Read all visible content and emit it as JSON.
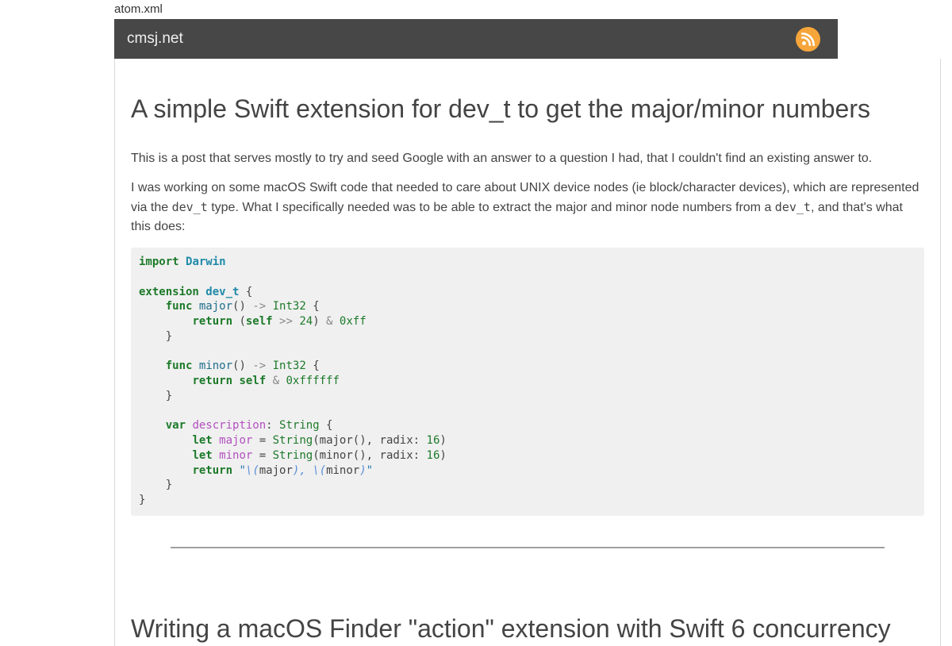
{
  "top_link": {
    "label": "atom.xml"
  },
  "header": {
    "site_title": "cmsj.net",
    "feed_icon": "rss-icon",
    "colors": {
      "bar": "#474747",
      "feed": "#f5a53a"
    }
  },
  "post": {
    "title": "A simple Swift extension for dev_t to get the major/minor numbers",
    "paragraph1": "This is a post that serves mostly to try and seed Google with an answer to a question I had, that I couldn't find an existing answer to.",
    "paragraph2": {
      "text_a": "I was working on some macOS Swift code that needed to care about UNIX device nodes (ie block/character devices), which are represented via the ",
      "code_a": "dev_t",
      "text_b": " type. What I specifically needed was to be able to extract the major and minor node numbers from a ",
      "code_b": "dev_t",
      "text_c": ", and that's what this does:"
    },
    "code": {
      "import_kw": "import",
      "import_mod": "Darwin",
      "extension_kw": "extension",
      "extension_type": "dev_t",
      "func_kw": "func",
      "major_name": "major",
      "minor_name": "minor",
      "arrow": "->",
      "int32": "Int32",
      "return_kw": "return",
      "self_kw": "self",
      "shift_op": ">>",
      "and_op": "&",
      "num_24": "24",
      "mask_ff": "0xff",
      "mask_ffffff": "0xffffff",
      "var_kw": "var",
      "description_name": "description",
      "string_type": "String",
      "let_kw": "let",
      "radix_label": "radix",
      "num_16": "16",
      "interp_open": "\\(",
      "interp_close": ")",
      "interp_sep": ", "
    },
    "colors": {
      "code_bg": "#f0f0f0",
      "keyword": "#1d7a2a",
      "type": "#1f8aa8",
      "property": "#b24fbf"
    }
  },
  "next_post": {
    "title": "Writing a macOS Finder \"action\" extension with Swift 6 concurrency"
  }
}
